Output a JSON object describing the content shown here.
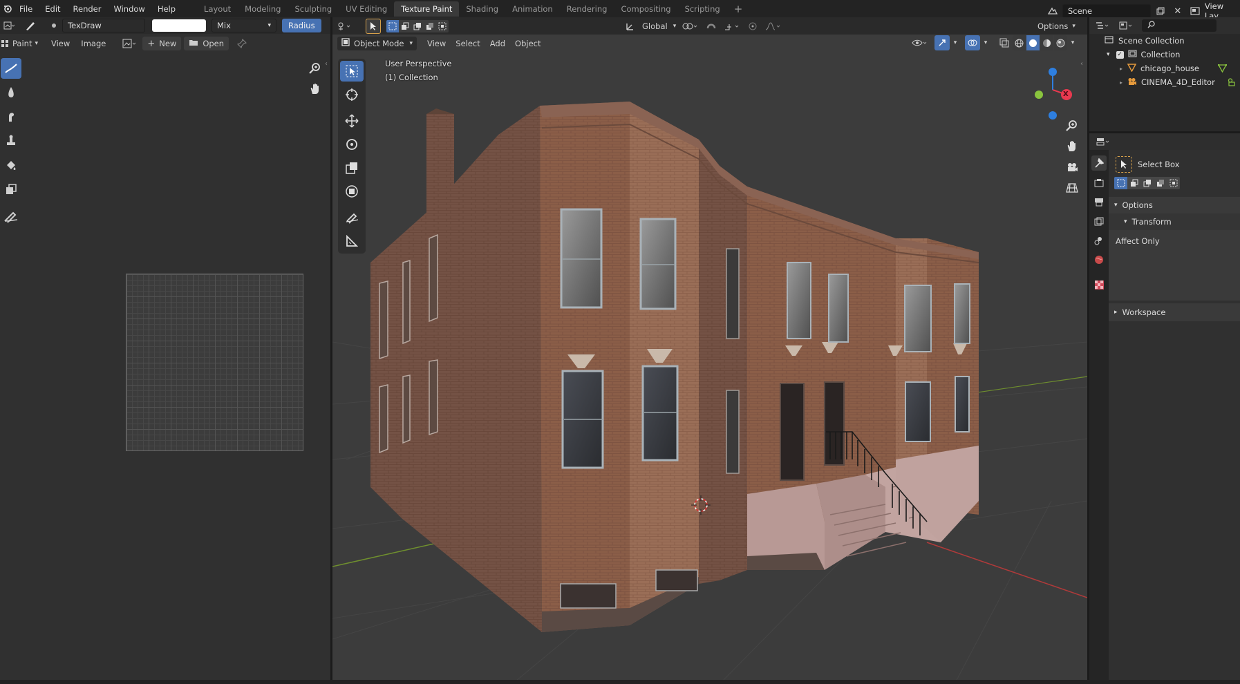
{
  "topbar": {
    "menus": [
      "File",
      "Edit",
      "Render",
      "Window",
      "Help"
    ],
    "tabs": [
      "Layout",
      "Modeling",
      "Sculpting",
      "UV Editing",
      "Texture Paint",
      "Shading",
      "Animation",
      "Rendering",
      "Compositing",
      "Scripting"
    ],
    "active_tab": "Texture Paint",
    "add_tab": "+",
    "scene_label": "Scene",
    "view_layer_label": "View Lay"
  },
  "image_editor": {
    "brush_name": "TexDraw",
    "blend_mode": "Mix",
    "radius_label": "Radius",
    "mode_label": "Paint",
    "view_menu": "View",
    "image_menu": "Image",
    "new_label": "New",
    "open_label": "Open"
  },
  "viewport": {
    "transform_orientation": "Global",
    "options_label": "Options",
    "mode_label": "Object Mode",
    "menus": [
      "View",
      "Select",
      "Add",
      "Object"
    ],
    "overlay_title": "User Perspective",
    "overlay_subtitle": "(1) Collection",
    "gizmo_x": "X"
  },
  "outliner": {
    "items": [
      {
        "label": "Scene Collection",
        "icon": "scene-collection-icon"
      },
      {
        "label": "Collection",
        "icon": "collection-icon"
      },
      {
        "label": "chicago_house",
        "icon": "mesh-icon"
      },
      {
        "label": "CINEMA_4D_Editor",
        "icon": "camera-icon"
      }
    ]
  },
  "properties": {
    "tool_name": "Select Box",
    "options_label": "Options",
    "transform_label": "Transform",
    "affect_only_label": "Affect Only",
    "workspace_label": "Workspace"
  },
  "colors": {
    "accent": "#4772b3",
    "axis_x": "#e8394f",
    "axis_y": "#8ac43e",
    "axis_z": "#2e7fe0"
  }
}
